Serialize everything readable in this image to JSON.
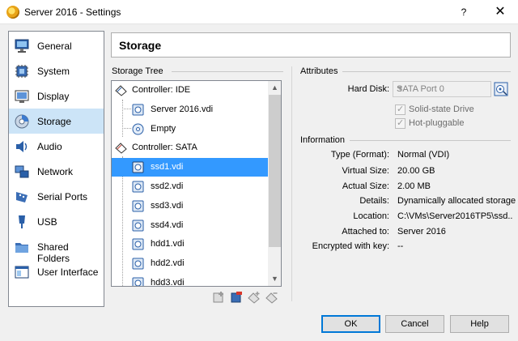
{
  "window": {
    "title": "Server 2016 - Settings",
    "help_glyph": "?",
    "close_glyph": "✕"
  },
  "categories": [
    {
      "label": "General",
      "icon": "monitor-icon"
    },
    {
      "label": "System",
      "icon": "chip-icon"
    },
    {
      "label": "Display",
      "icon": "display-icon"
    },
    {
      "label": "Storage",
      "icon": "disk-icon",
      "selected": true
    },
    {
      "label": "Audio",
      "icon": "speaker-icon"
    },
    {
      "label": "Network",
      "icon": "network-icon"
    },
    {
      "label": "Serial Ports",
      "icon": "serial-port-icon"
    },
    {
      "label": "USB",
      "icon": "usb-icon"
    },
    {
      "label": "Shared Folders",
      "icon": "folder-icon"
    },
    {
      "label": "User Interface",
      "icon": "window-icon"
    }
  ],
  "page_heading": "Storage",
  "storage_tree": {
    "label": "Storage Tree",
    "controllers": [
      {
        "label": "Controller: IDE",
        "items": [
          "Server 2016.vdi",
          "Empty"
        ]
      },
      {
        "label": "Controller: SATA",
        "items": [
          "ssd1.vdi",
          "ssd2.vdi",
          "ssd3.vdi",
          "ssd4.vdi",
          "hdd1.vdi",
          "hdd2.vdi",
          "hdd3.vdi"
        ]
      }
    ],
    "selected_item": "ssd1.vdi",
    "scroll_up": "▲",
    "scroll_down": "▼"
  },
  "attributes": {
    "section_label": "Attributes",
    "hard_disk_label": "Hard Disk:",
    "hard_disk_value": "SATA Port 0",
    "solid_state_label": "Solid-state Drive",
    "solid_state_checked": true,
    "hot_pluggable_label": "Hot-pluggable",
    "hot_pluggable_checked": true
  },
  "information": {
    "section_label": "Information",
    "rows": [
      {
        "label": "Type (Format):",
        "value": "Normal (VDI)"
      },
      {
        "label": "Virtual Size:",
        "value": "20.00 GB"
      },
      {
        "label": "Actual Size:",
        "value": "2.00 MB"
      },
      {
        "label": "Details:",
        "value": "Dynamically allocated storage"
      },
      {
        "label": "Location:",
        "value": "C:\\VMs\\Server2016TP5\\ssd..."
      },
      {
        "label": "Attached to:",
        "value": "Server 2016"
      },
      {
        "label": "Encrypted with key:",
        "value": "--"
      }
    ]
  },
  "buttons": {
    "ok": "OK",
    "cancel": "Cancel",
    "help": "Help"
  },
  "colors": {
    "selection": "#3399ff",
    "category_selection": "#cce4f7",
    "default_button_border": "#0078d7"
  }
}
